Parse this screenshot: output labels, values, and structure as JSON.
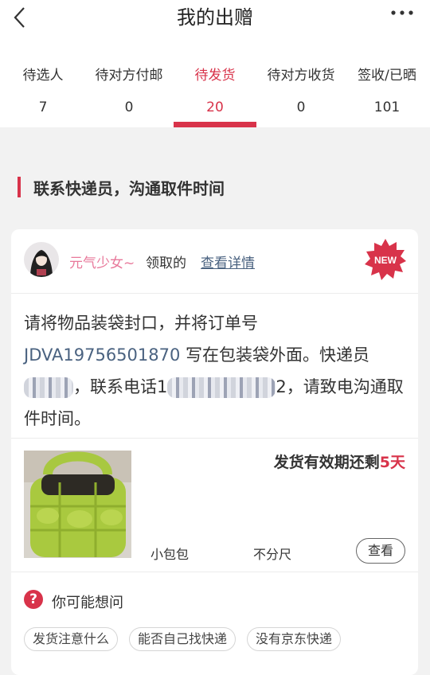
{
  "header": {
    "title": "我的出赠",
    "back_icon": "chevron-left-icon",
    "more_icon": "more-dots-icon"
  },
  "tabs": [
    {
      "label": "待选人",
      "count": "7"
    },
    {
      "label": "待对方付邮",
      "count": "0"
    },
    {
      "label": "待发货",
      "count": "20"
    },
    {
      "label": "待对方收货",
      "count": "0"
    },
    {
      "label": "签收/已晒",
      "count": "101"
    }
  ],
  "active_tab": 2,
  "section": {
    "title": "联系快递员，沟通取件时间"
  },
  "card": {
    "user_name": "元气少女~",
    "claimed_text": "领取的",
    "details_link": "查看详情",
    "badge": "NEW",
    "message": {
      "part1": "请将物品装袋封口，并将订单号 ",
      "order_no": "JDVA19756501870",
      "part2": " 写在包装袋外面。快递员",
      "part3": "，联系电话1",
      "part4": "2，请致电沟通取件时间。"
    },
    "deadline_label": "发货有效期还剩",
    "deadline_value": "5天",
    "item_name": "小包包",
    "item_size": "不分尺",
    "view_button": "查看"
  },
  "faq": {
    "icon": "question-icon",
    "title": "你可能想问",
    "chips": [
      "发货注意什么",
      "能否自己找快递",
      "没有京东快递"
    ]
  },
  "colors": {
    "accent": "#d8334a",
    "link": "#4a6280",
    "username": "#e8789a"
  }
}
